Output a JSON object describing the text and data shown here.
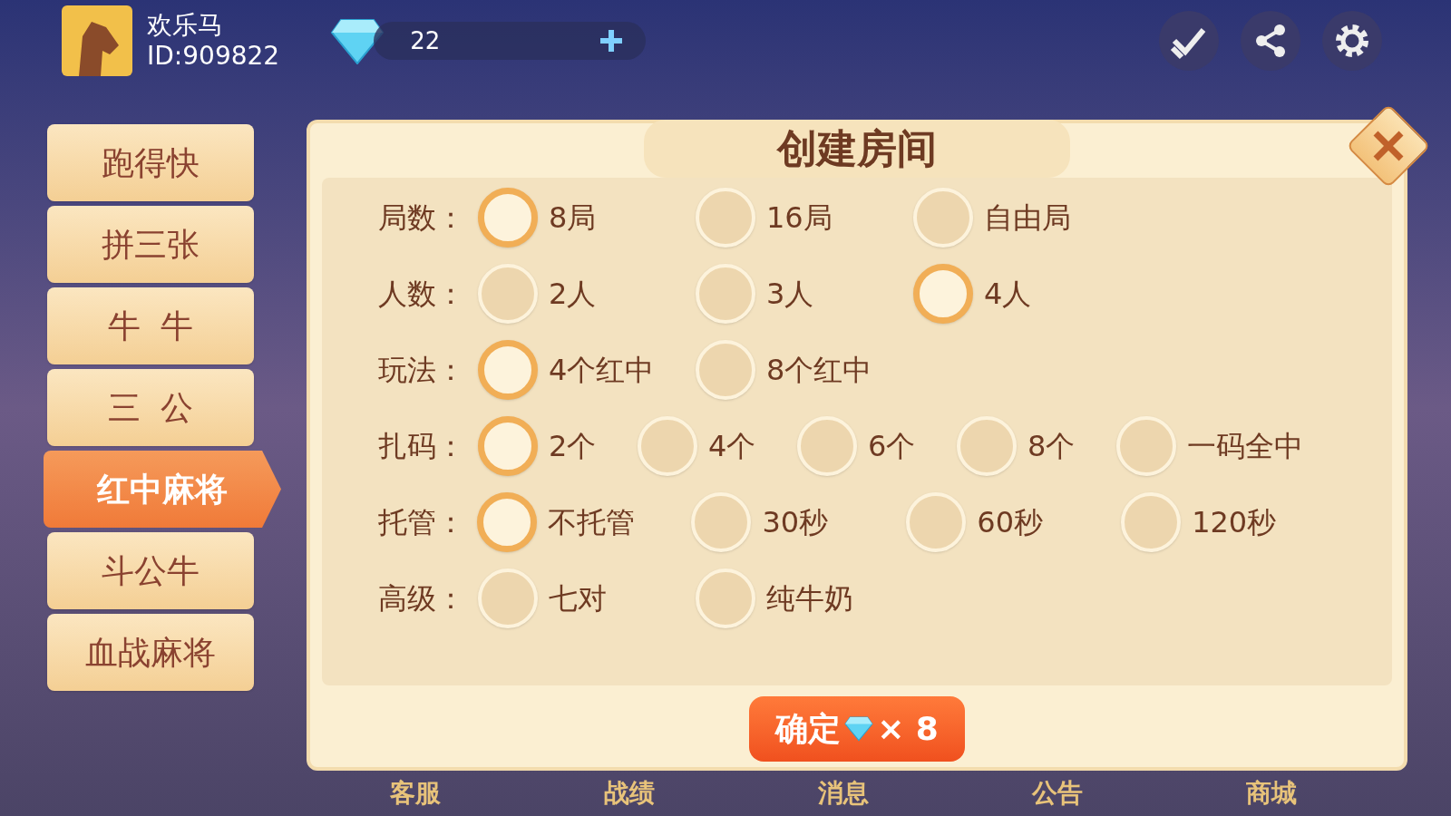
{
  "user": {
    "name": "欢乐马",
    "id": "ID:909822"
  },
  "diamonds": {
    "count": "22"
  },
  "games": [
    {
      "label": "跑得快",
      "selected": false
    },
    {
      "label": "拼三张",
      "selected": false
    },
    {
      "label": "牛  牛",
      "selected": false
    },
    {
      "label": "三  公",
      "selected": false
    },
    {
      "label": "红中麻将",
      "selected": true
    },
    {
      "label": "斗公牛",
      "selected": false
    },
    {
      "label": "血战麻将",
      "selected": false
    }
  ],
  "dialog": {
    "title": "创建房间",
    "rows": [
      {
        "label": "局数：",
        "options": [
          {
            "label": "8局",
            "selected": true
          },
          {
            "label": "16局",
            "selected": false
          },
          {
            "label": "自由局",
            "selected": false
          }
        ]
      },
      {
        "label": "人数：",
        "options": [
          {
            "label": "2人",
            "selected": false
          },
          {
            "label": "3人",
            "selected": false
          },
          {
            "label": "4人",
            "selected": true
          }
        ]
      },
      {
        "label": "玩法：",
        "options": [
          {
            "label": "4个红中",
            "selected": true
          },
          {
            "label": "8个红中",
            "selected": false
          }
        ]
      },
      {
        "label": "扎码：",
        "options": [
          {
            "label": "2个",
            "selected": true
          },
          {
            "label": "4个",
            "selected": false
          },
          {
            "label": "6个",
            "selected": false
          },
          {
            "label": "8个",
            "selected": false
          },
          {
            "label": "一码全中",
            "selected": false
          }
        ]
      },
      {
        "label": "托管：",
        "options": [
          {
            "label": "不托管",
            "selected": true
          },
          {
            "label": "30秒",
            "selected": false
          },
          {
            "label": "60秒",
            "selected": false
          },
          {
            "label": "120秒",
            "selected": false
          }
        ]
      },
      {
        "label": "高级：",
        "options": [
          {
            "label": "七对",
            "selected": false
          },
          {
            "label": "纯牛奶",
            "selected": false
          }
        ]
      }
    ],
    "confirm": {
      "label": "确定",
      "multiplier": "× 8"
    }
  },
  "bottom_nav": [
    "客服",
    "战绩",
    "消息",
    "公告",
    "商城"
  ]
}
